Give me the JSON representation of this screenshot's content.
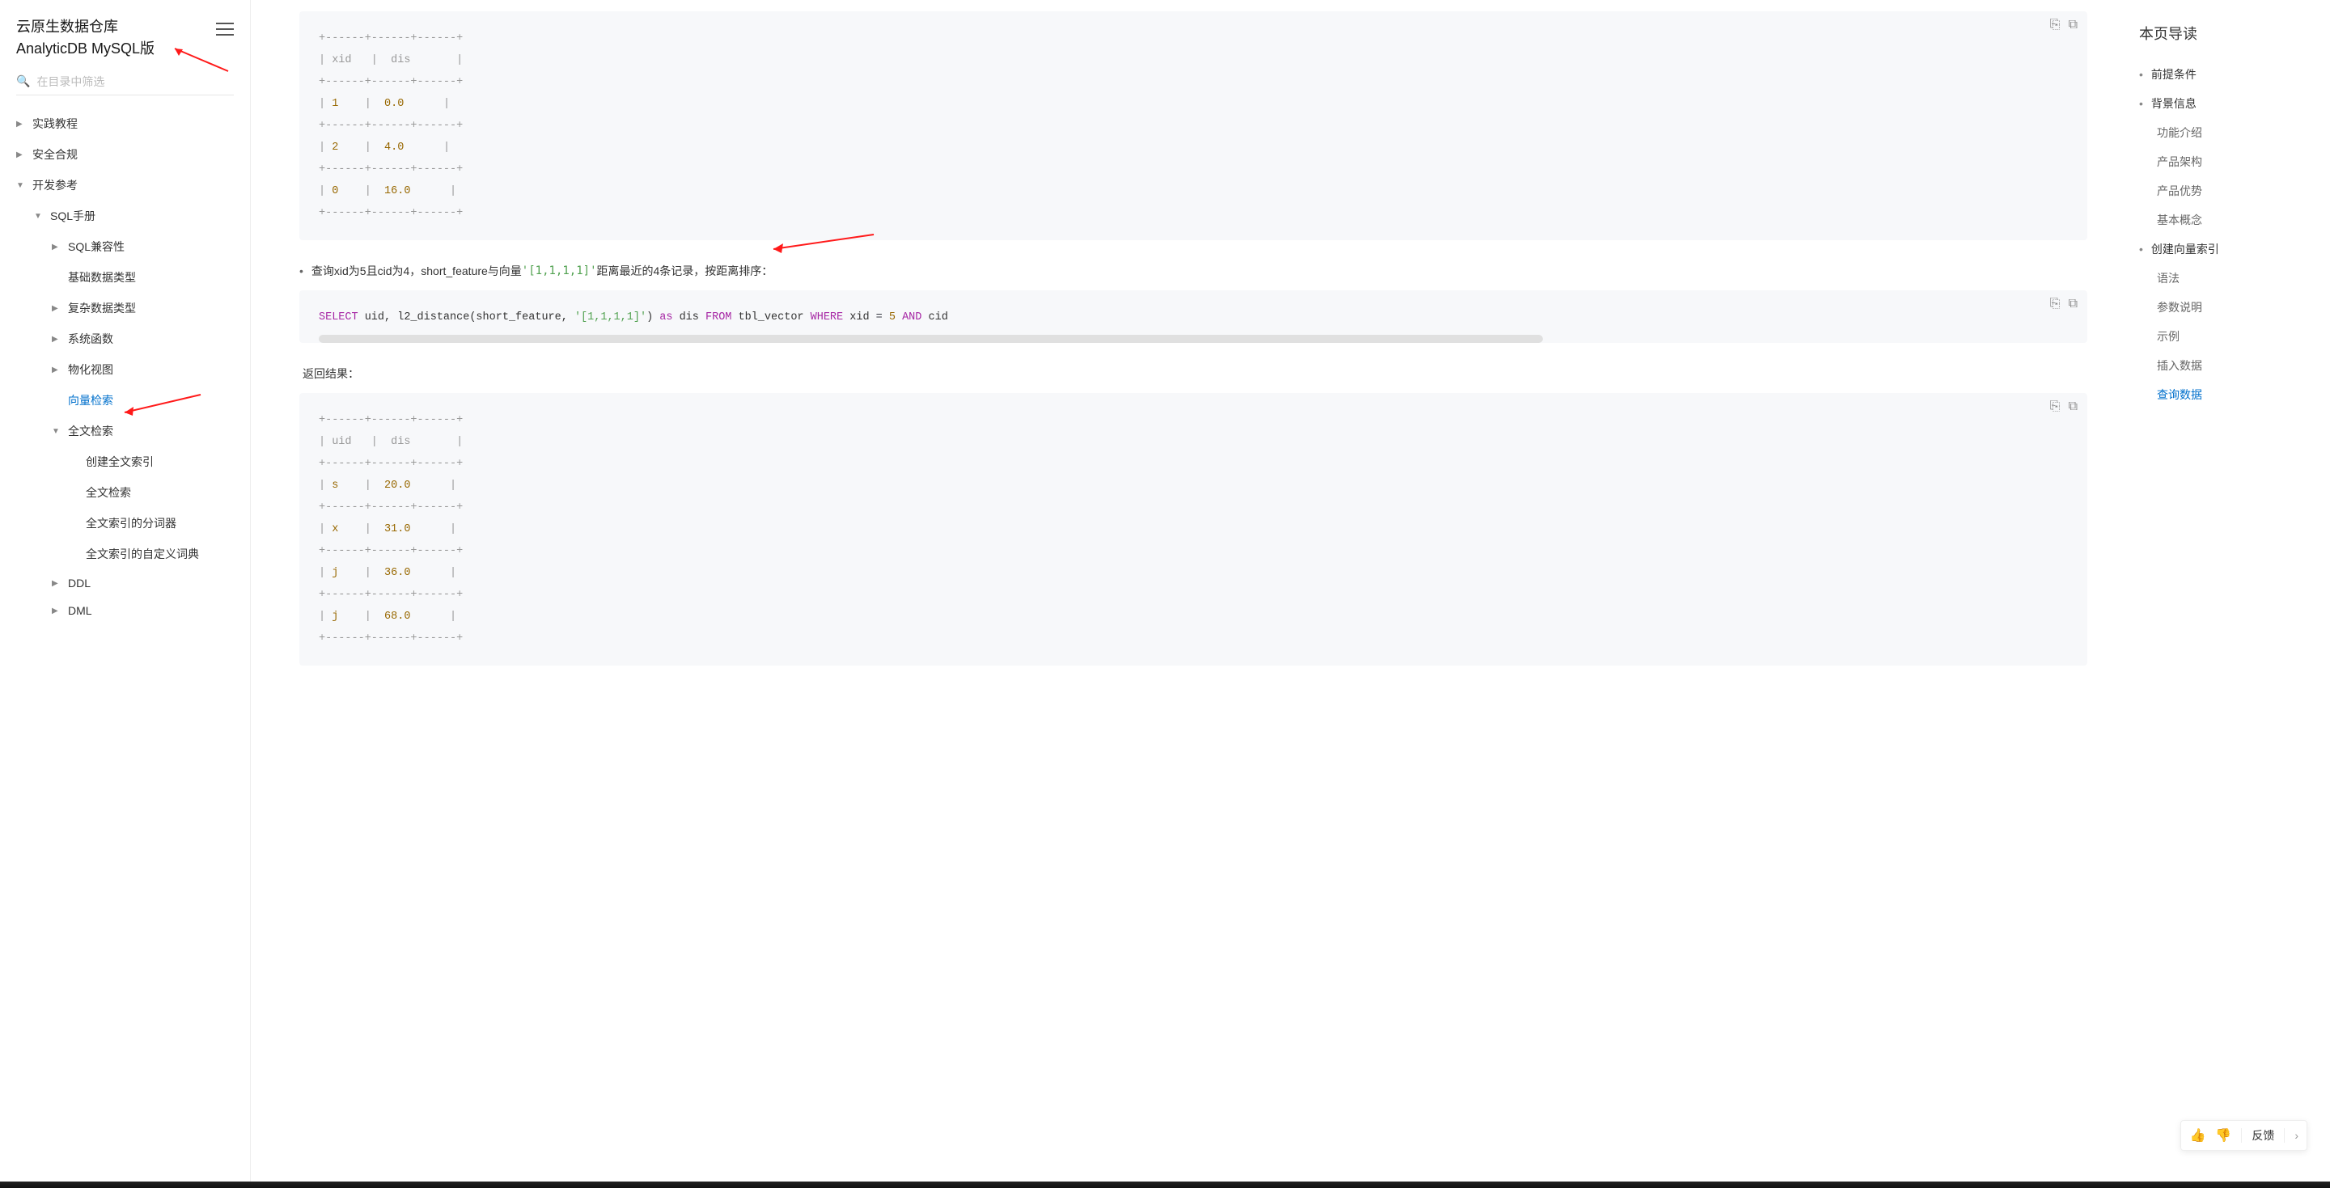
{
  "sidebar": {
    "title_line1": "云原生数据仓库",
    "title_line2": "AnalyticDB MySQL版",
    "search_placeholder": "在目录中筛选",
    "items": [
      {
        "label": "实践教程",
        "level": 0,
        "caret": "▶",
        "active": false
      },
      {
        "label": "安全合规",
        "level": 0,
        "caret": "▶",
        "active": false
      },
      {
        "label": "开发参考",
        "level": 0,
        "caret": "▼",
        "active": false
      },
      {
        "label": "SQL手册",
        "level": 1,
        "caret": "▼",
        "active": false
      },
      {
        "label": "SQL兼容性",
        "level": 2,
        "caret": "▶",
        "active": false
      },
      {
        "label": "基础数据类型",
        "level": 2,
        "caret": "",
        "active": false
      },
      {
        "label": "复杂数据类型",
        "level": 2,
        "caret": "▶",
        "active": false
      },
      {
        "label": "系统函数",
        "level": 2,
        "caret": "▶",
        "active": false
      },
      {
        "label": "物化视图",
        "level": 2,
        "caret": "▶",
        "active": false
      },
      {
        "label": "向量检索",
        "level": 2,
        "caret": "",
        "active": true
      },
      {
        "label": "全文检索",
        "level": 2,
        "caret": "▼",
        "active": false
      },
      {
        "label": "创建全文索引",
        "level": 3,
        "caret": "",
        "active": false
      },
      {
        "label": "全文检索",
        "level": 3,
        "caret": "",
        "active": false
      },
      {
        "label": "全文索引的分词器",
        "level": 3,
        "caret": "",
        "active": false
      },
      {
        "label": "全文索引的自定义词典",
        "level": 3,
        "caret": "",
        "active": false
      },
      {
        "label": "DDL",
        "level": 2,
        "caret": "▶",
        "active": false
      },
      {
        "label": "DML",
        "level": 2,
        "caret": "▶",
        "active": false
      }
    ]
  },
  "main": {
    "table1": {
      "sep": "+------+------+------+",
      "header": "| xid   |  dis       |",
      "rows": [
        {
          "c1": "1",
          "c2": "0.0"
        },
        {
          "c1": "2",
          "c2": "4.0"
        },
        {
          "c1": "0",
          "c2": "16.0"
        }
      ]
    },
    "bullet_pre": "查询xid为5且cid为4，short_feature与向量 ",
    "bullet_code": "'[1,1,1,1]'",
    "bullet_post": " 距离最近的4条记录，按距离排序：",
    "sql": {
      "select": "SELECT",
      "cols": " uid, l2_distance(short_feature, ",
      "vec": "'[1,1,1,1]'",
      "paren": ") ",
      "as": "as",
      "dis": " dis ",
      "from": "FROM",
      "tbl": " tbl_vector ",
      "where": "WHERE",
      "cond1a": " xid ",
      "eq1": "=",
      "cond1b": " 5 ",
      "and": "AND",
      "cond2": " cid"
    },
    "result_label": "返回结果：",
    "table2": {
      "sep": "+------+------+------+",
      "header": "| uid   |  dis       |",
      "rows": [
        {
          "c1": "s",
          "c2": "20.0"
        },
        {
          "c1": "x",
          "c2": "31.0"
        },
        {
          "c1": "j",
          "c2": "36.0"
        },
        {
          "c1": "j",
          "c2": "68.0"
        }
      ]
    }
  },
  "toc": {
    "title": "本页导读",
    "items": [
      {
        "label": "前提条件",
        "level": 0,
        "active": false
      },
      {
        "label": "背景信息",
        "level": 0,
        "active": false
      },
      {
        "label": "功能介绍",
        "level": 1,
        "active": false
      },
      {
        "label": "产品架构",
        "level": 1,
        "active": false
      },
      {
        "label": "产品优势",
        "level": 1,
        "active": false
      },
      {
        "label": "基本概念",
        "level": 1,
        "active": false
      },
      {
        "label": "创建向量索引",
        "level": 0,
        "active": false
      },
      {
        "label": "语法",
        "level": 1,
        "active": false
      },
      {
        "label": "参数说明",
        "level": 1,
        "active": false
      },
      {
        "label": "示例",
        "level": 1,
        "active": false
      },
      {
        "label": "插入数据",
        "level": 1,
        "active": false
      },
      {
        "label": "查询数据",
        "level": 1,
        "active": true
      }
    ]
  },
  "feedback": {
    "label": "反馈"
  }
}
